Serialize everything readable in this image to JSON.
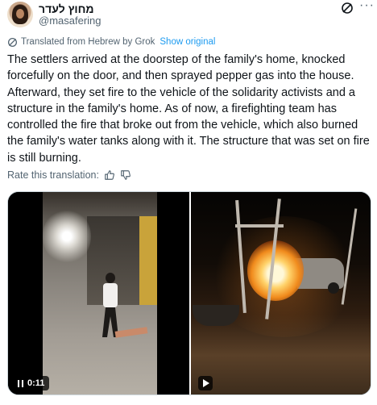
{
  "author": {
    "display_name": "מחוץ לעדר",
    "handle": "@masafering",
    "avatar_icon": "profile-photo"
  },
  "header_icons": [
    "grok-icon",
    "more-icon"
  ],
  "translation": {
    "notice": "Translated from Hebrew by Grok",
    "show_original": "Show original"
  },
  "tweet": {
    "text": "The settlers arrived at the doorstep of the family's home, knocked forcefully on the door, and then sprayed pepper gas into the house. Afterward, they set fire to the vehicle of the solidarity activists and a structure in the family's home. As of now, a firefighting team has controlled the fire that broke out from the vehicle, which also burned the family's water tanks along with it. The structure that was set on fire is still burning."
  },
  "rate": {
    "label": "Rate this translation:",
    "icons": [
      "thumbs-up-icon",
      "thumbs-down-icon"
    ]
  },
  "media": {
    "video_left": {
      "duration": "0:11",
      "state": "playing"
    },
    "video_right": {
      "state": "paused"
    }
  },
  "colors": {
    "text": "#0f1419",
    "secondary": "#536471",
    "link": "#1d9bf0",
    "border": "#cfd9de"
  }
}
